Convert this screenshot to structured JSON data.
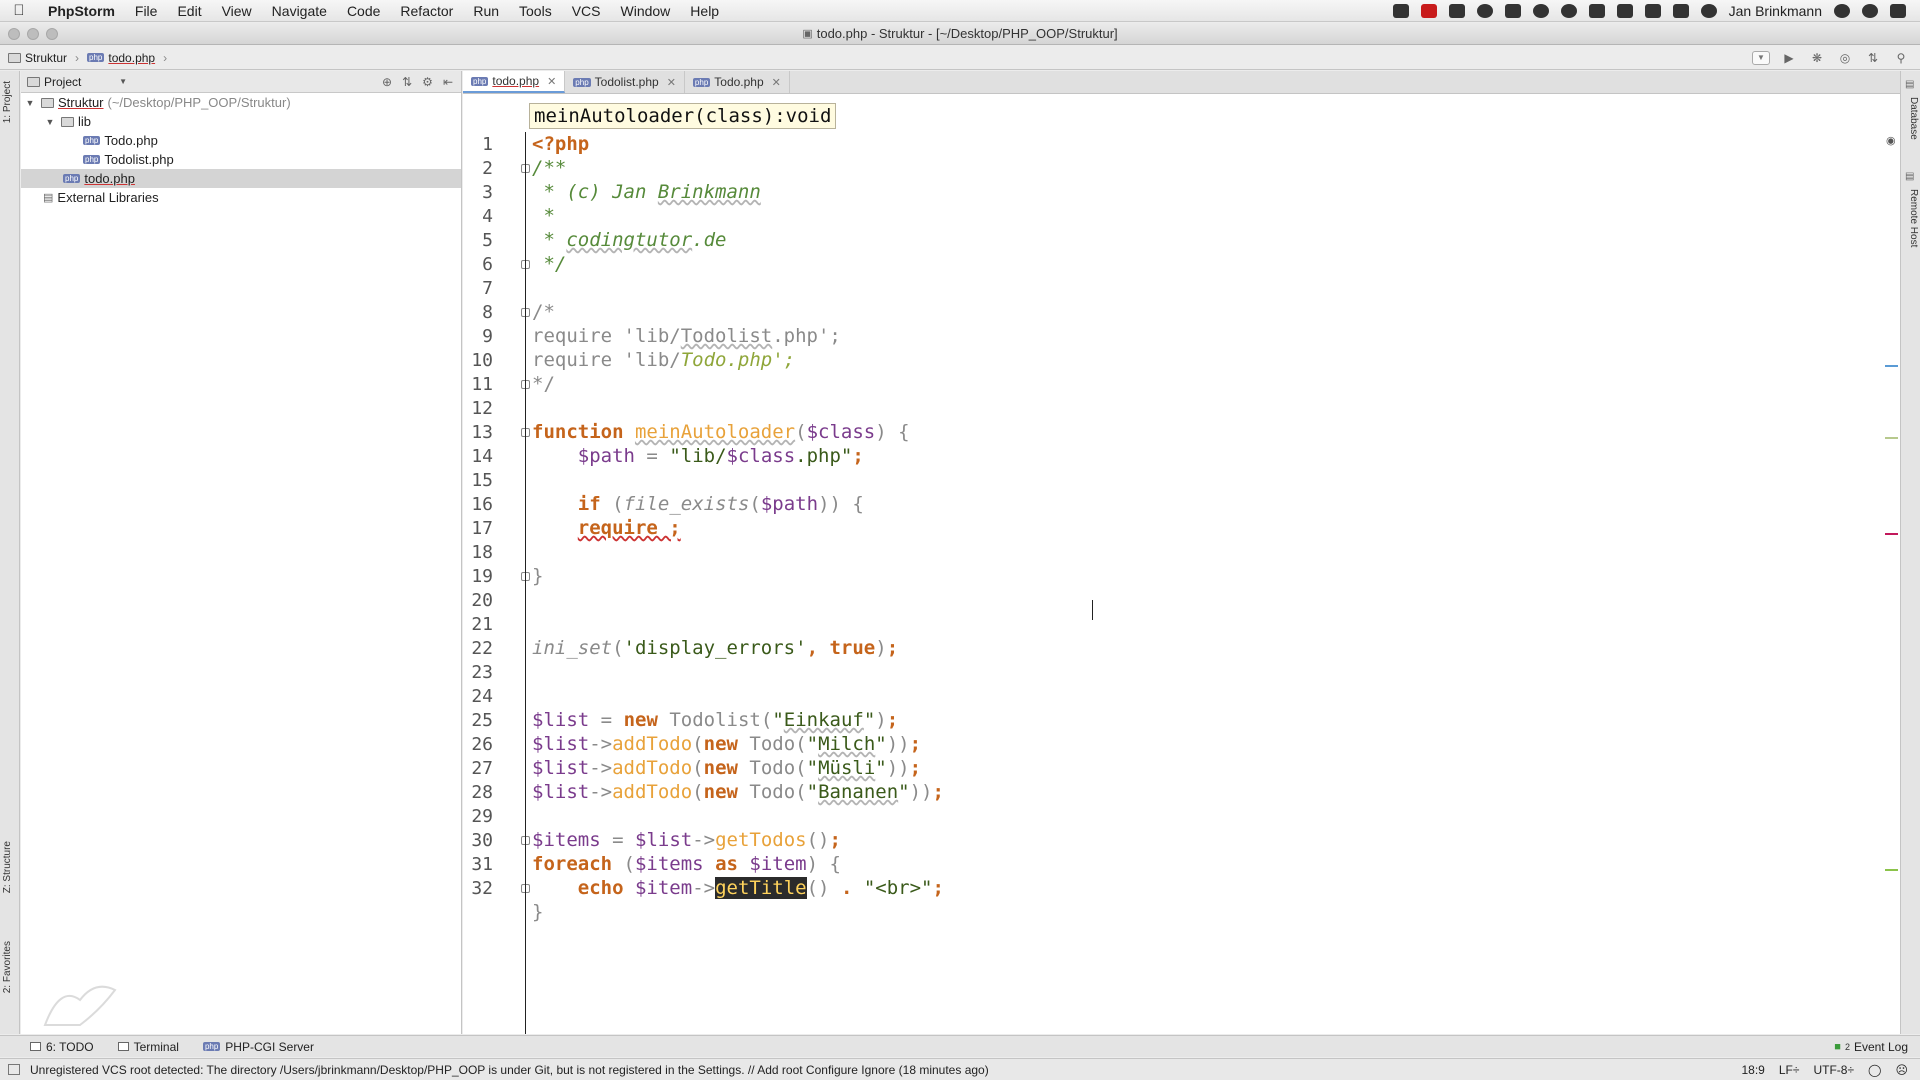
{
  "menubar": {
    "app_name": "PhpStorm",
    "items": [
      "File",
      "Edit",
      "View",
      "Navigate",
      "Code",
      "Refactor",
      "Run",
      "Tools",
      "VCS",
      "Window",
      "Help"
    ],
    "user": "Jan Brinkmann"
  },
  "window": {
    "title": "todo.php - Struktur - [~/Desktop/PHP_OOP/Struktur]"
  },
  "navbar": {
    "crumb_project": "Struktur",
    "crumb_file": "todo.php"
  },
  "left_stripe": {
    "project_label": "1: Project",
    "structure_label": "Z: Structure",
    "favorites_label": "2: Favorites"
  },
  "right_stripe": {
    "database_label": "Database",
    "remote_label": "Remote Host"
  },
  "project_panel": {
    "selector_label": "Project",
    "tree": {
      "root_name": "Struktur",
      "root_path": "(~/Desktop/PHP_OOP/Struktur)",
      "lib": "lib",
      "todo_class": "Todo.php",
      "todolist_class": "Todolist.php",
      "todo_file": "todo.php",
      "external": "External Libraries"
    }
  },
  "tabs": [
    {
      "label": "todo.php",
      "active": true
    },
    {
      "label": "Todolist.php",
      "active": false
    },
    {
      "label": "Todo.php",
      "active": false
    }
  ],
  "editor": {
    "hint": "meinAutoloader(class):void",
    "line_numbers": [
      "1",
      "2",
      "3",
      "4",
      "5",
      "6",
      "7",
      "8",
      "9",
      "10",
      "11",
      "12",
      "13",
      "14",
      "15",
      "16",
      "17",
      "18",
      "19",
      "20",
      "21",
      "22",
      "23",
      "24",
      "25",
      "26",
      "27",
      "28",
      "29",
      "30",
      "31",
      "32"
    ]
  },
  "bottom_tools": {
    "todo": "6: TODO",
    "terminal": "Terminal",
    "server": "PHP-CGI Server",
    "event_log": "Event Log",
    "event_count": "2"
  },
  "status": {
    "message": "Unregistered VCS root detected: The directory /Users/jbrinkmann/Desktop/PHP_OOP is under Git, but is not registered in the Settings. // Add root  Configure  Ignore (18 minutes ago)",
    "position": "18:9",
    "line_sep": "LF÷",
    "encoding": "UTF-8÷"
  },
  "colors": {
    "keyword": "#c5641b",
    "comment": "#568a3a",
    "variable": "#7a3b8c",
    "function": "#e8a23a"
  }
}
